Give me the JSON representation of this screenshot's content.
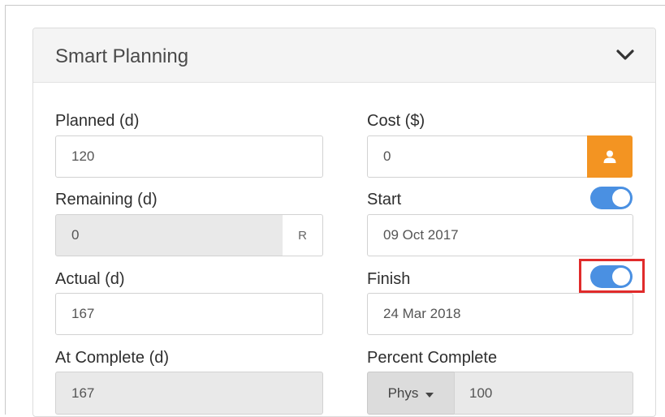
{
  "panel": {
    "title": "Smart Planning"
  },
  "fields": {
    "planned": {
      "label": "Planned (d)",
      "value": "120"
    },
    "remaining": {
      "label": "Remaining (d)",
      "value": "0",
      "addon": "R"
    },
    "actual": {
      "label": "Actual (d)",
      "value": "167"
    },
    "at_complete": {
      "label": "At Complete (d)",
      "value": "167"
    },
    "cost": {
      "label": "Cost ($)",
      "value": "0"
    },
    "start": {
      "label": "Start",
      "value": "09 Oct 2017",
      "toggle_on": true
    },
    "finish": {
      "label": "Finish",
      "value": "24 Mar 2018",
      "toggle_on": true
    },
    "percent_complete": {
      "label": "Percent Complete",
      "type_selected": "Phys",
      "value": "100"
    }
  },
  "colors": {
    "accent_orange": "#f39422",
    "toggle_blue": "#4a90e2",
    "highlight_red": "#e02b2b"
  },
  "icons": {
    "collapse": "chevron-down-icon",
    "person": "user-icon",
    "dropdown": "caret-down-icon"
  }
}
